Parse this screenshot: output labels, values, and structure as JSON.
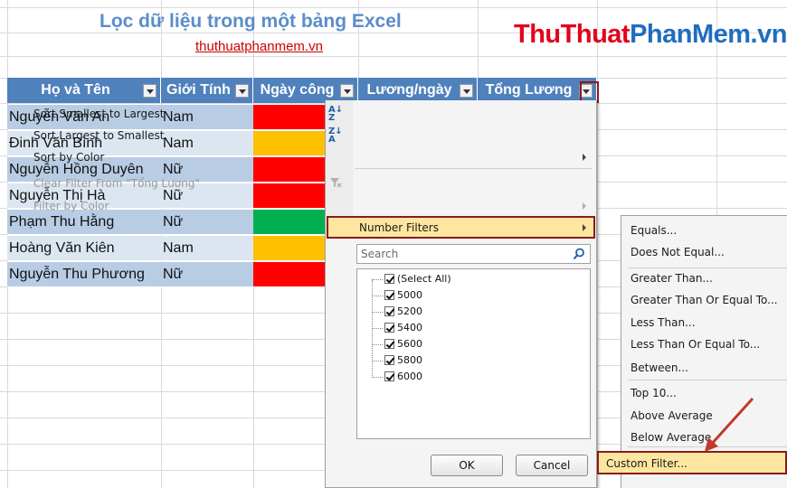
{
  "title": "Lọc dữ liệu trong một bảng Excel",
  "subtitle": "thuthuatphanmem.vn",
  "brand": {
    "part1": "ThuThuat",
    "part2": "PhanMem.vn"
  },
  "colors": {
    "header": "#4f81bd",
    "red": "#ff0000",
    "orange": "#ffc000",
    "green": "#00b050",
    "highlight": "#fde7a0",
    "brand_red": "#e3001b",
    "brand_blue": "#1f6dbf"
  },
  "table": {
    "headers": [
      "Họ và Tên",
      "Giới Tính",
      "Ngày công",
      "Lương/ngày",
      "Tổng Lương"
    ],
    "rows": [
      {
        "name": "Nguyễn Văn An",
        "gender": "Nam",
        "color": "red"
      },
      {
        "name": "Đinh Văn Bình",
        "gender": "Nam",
        "color": "orange"
      },
      {
        "name": "Nguyễn Hồng Duyên",
        "gender": "Nữ",
        "color": "red"
      },
      {
        "name": "Nguyễn Thị Hà",
        "gender": "Nữ",
        "color": "red"
      },
      {
        "name": "Phạm Thu Hằng",
        "gender": "Nữ",
        "color": "green"
      },
      {
        "name": "Hoàng Văn Kiên",
        "gender": "Nam",
        "color": "orange"
      },
      {
        "name": "Nguyễn Thu Phương",
        "gender": "Nữ",
        "color": "red"
      }
    ]
  },
  "menu": {
    "sort_asc": "Sort Smallest to Largest",
    "sort_desc": "Sort Largest to Smallest",
    "sort_color": "Sort by Color",
    "clear_filter": "Clear Filter From \"Tổng Lương\"",
    "filter_color": "Filter by Color",
    "number_filters": "Number Filters",
    "search_placeholder": "Search",
    "items": [
      "(Select All)",
      "5000",
      "5200",
      "5400",
      "5600",
      "5800",
      "6000"
    ],
    "ok": "OK",
    "cancel": "Cancel"
  },
  "submenu": {
    "items": [
      "Equals...",
      "Does Not Equal...",
      "Greater Than...",
      "Greater Than Or Equal To...",
      "Less Than...",
      "Less Than Or Equal To...",
      "Between...",
      "Top 10...",
      "Above Average",
      "Below Average",
      "Custom Filter..."
    ]
  }
}
